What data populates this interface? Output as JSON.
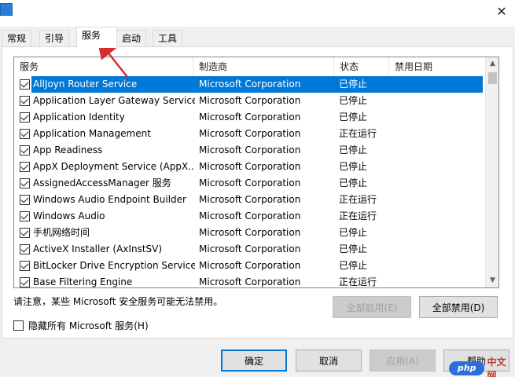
{
  "tabs": [
    {
      "label": "常规"
    },
    {
      "label": "引导"
    },
    {
      "label": "服务"
    },
    {
      "label": "启动"
    },
    {
      "label": "工具"
    }
  ],
  "titlebar": {
    "close": "✕"
  },
  "list": {
    "columns": [
      "服务",
      "制造商",
      "状态",
      "禁用日期"
    ],
    "rows": [
      {
        "name": "AllJoyn Router Service",
        "mfr": "Microsoft Corporation",
        "status": "已停止",
        "selected": true
      },
      {
        "name": "Application Layer Gateway Service",
        "mfr": "Microsoft Corporation",
        "status": "已停止"
      },
      {
        "name": "Application Identity",
        "mfr": "Microsoft Corporation",
        "status": "已停止"
      },
      {
        "name": "Application Management",
        "mfr": "Microsoft Corporation",
        "status": "正在运行"
      },
      {
        "name": "App Readiness",
        "mfr": "Microsoft Corporation",
        "status": "已停止"
      },
      {
        "name": "AppX Deployment Service (AppX...",
        "mfr": "Microsoft Corporation",
        "status": "已停止"
      },
      {
        "name": "AssignedAccessManager 服务",
        "mfr": "Microsoft Corporation",
        "status": "已停止"
      },
      {
        "name": "Windows Audio Endpoint Builder",
        "mfr": "Microsoft Corporation",
        "status": "正在运行"
      },
      {
        "name": "Windows Audio",
        "mfr": "Microsoft Corporation",
        "status": "正在运行"
      },
      {
        "name": "手机网络时间",
        "mfr": "Microsoft Corporation",
        "status": "已停止"
      },
      {
        "name": "ActiveX Installer (AxInstSV)",
        "mfr": "Microsoft Corporation",
        "status": "已停止"
      },
      {
        "name": "BitLocker Drive Encryption Service",
        "mfr": "Microsoft Corporation",
        "status": "已停止"
      },
      {
        "name": "Base Filtering Engine",
        "mfr": "Microsoft Corporation",
        "status": "正在运行"
      }
    ]
  },
  "notice": "请注意，某些 Microsoft 安全服务可能无法禁用。",
  "buttons": {
    "enable_all": "全部启用(E)",
    "disable_all": "全部禁用(D)",
    "ok": "确定",
    "cancel": "取消",
    "apply": "应用(A)",
    "help": "帮助"
  },
  "hide_ms": "隐藏所有 Microsoft 服务(H)",
  "colors": {
    "selection": "#0078d7",
    "annotation_arrow": "#d32f2f"
  },
  "watermark": {
    "logo": "php",
    "text": "中文网"
  }
}
